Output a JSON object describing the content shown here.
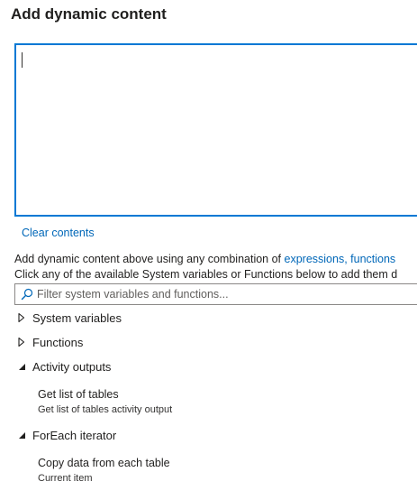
{
  "panel": {
    "title": "Add dynamic content"
  },
  "editor": {
    "value": ""
  },
  "clear_link": "Clear contents",
  "help": {
    "line1_prefix": "Add dynamic content above using any combination of ",
    "line1_link": "expressions, functions",
    "line2": "Click any of the available System variables or Functions below to add them d"
  },
  "filter": {
    "placeholder": "Filter system variables and functions...",
    "value": ""
  },
  "sections": {
    "system_variables": {
      "label": "System variables",
      "expanded": false
    },
    "functions": {
      "label": "Functions",
      "expanded": false
    },
    "activity_outputs": {
      "label": "Activity outputs",
      "expanded": true,
      "items": [
        {
          "name": "Get list of tables",
          "description": "Get list of tables activity output"
        }
      ]
    },
    "foreach_iterator": {
      "label": "ForEach iterator",
      "expanded": true,
      "items": [
        {
          "name": "Copy data from each table",
          "description": "Current item"
        }
      ]
    }
  },
  "colors": {
    "accent": "#0078d4",
    "link": "#0067b8",
    "text": "#201f1e"
  }
}
